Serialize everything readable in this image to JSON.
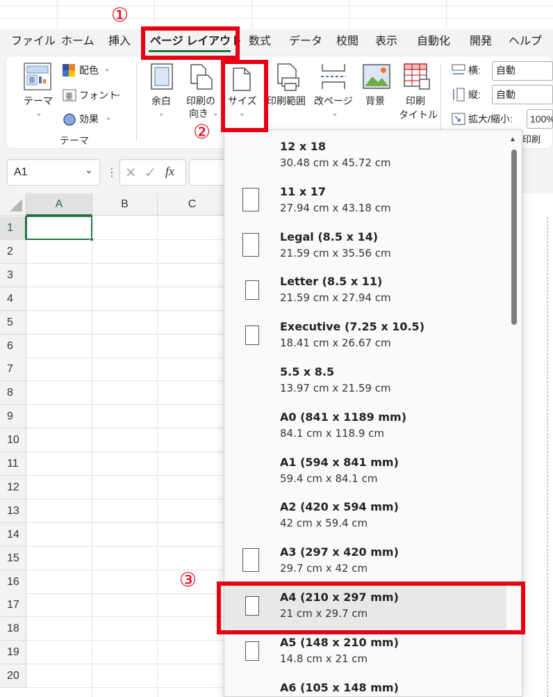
{
  "tabs": [
    {
      "label": "ファイル"
    },
    {
      "label": "ホーム"
    },
    {
      "label": "挿入"
    },
    {
      "label": "ページ レイアウト"
    },
    {
      "label": "数式"
    },
    {
      "label": "データ"
    },
    {
      "label": "校閲"
    },
    {
      "label": "表示"
    },
    {
      "label": "自動化"
    },
    {
      "label": "開発"
    },
    {
      "label": "ヘルプ"
    }
  ],
  "ribbon": {
    "theme_button": "テーマ",
    "colors": "配色",
    "fonts": "フォント",
    "effects": "効果",
    "group_theme": "テーマ",
    "margins_label": "余白",
    "orientation_label_1": "印刷の",
    "orientation_label_2": "向き",
    "size_label": "サイズ",
    "print_area_label": "印刷範囲",
    "breaks_label": "改ページ",
    "background_label": "背景",
    "print_titles_label_1": "印刷",
    "print_titles_label_2": "タイトル",
    "width_label": "横:",
    "width_value": "自動",
    "height_label": "縦:",
    "height_value": "自動",
    "scale_label": "拡大/縮小:",
    "scale_value": "100%",
    "group_print": "印刷"
  },
  "formula_bar": {
    "name_box": "A1",
    "fx": "fx"
  },
  "grid": {
    "columns": [
      "A",
      "B",
      "C"
    ],
    "rows": [
      "1",
      "2",
      "3",
      "4",
      "5",
      "6",
      "7",
      "8",
      "9",
      "10",
      "11",
      "12",
      "13",
      "14",
      "15",
      "16",
      "17",
      "18",
      "19",
      "20"
    ]
  },
  "size_menu": {
    "items": [
      {
        "title": "12 x 18",
        "sub": "30.48 cm x 45.72 cm",
        "icon": "none"
      },
      {
        "title": "11 x 17",
        "sub": "27.94 cm x 43.18 cm",
        "icon": "page-icon"
      },
      {
        "title": "Legal (8.5 x 14)",
        "sub": "21.59 cm x 35.56 cm",
        "icon": "page-icon"
      },
      {
        "title": "Letter (8.5 x 11)",
        "sub": "21.59 cm x 27.94 cm",
        "icon": "page-icon"
      },
      {
        "title": "Executive (7.25 x 10.5)",
        "sub": "18.41 cm x 26.67 cm",
        "icon": "page-icon"
      },
      {
        "title": "5.5 x 8.5",
        "sub": "13.97 cm x 21.59 cm",
        "icon": "none"
      },
      {
        "title": "A0 (841 x 1189 mm)",
        "sub": "84.1 cm x 118.9 cm",
        "icon": "none"
      },
      {
        "title": "A1 (594 x 841 mm)",
        "sub": "59.4 cm x 84.1 cm",
        "icon": "none"
      },
      {
        "title": "A2 (420 x 594 mm)",
        "sub": "42 cm x 59.4 cm",
        "icon": "none"
      },
      {
        "title": "A3 (297 x 420 mm)",
        "sub": "29.7 cm x 42 cm",
        "icon": "page-icon"
      },
      {
        "title": "A4 (210 x 297 mm)",
        "sub": "21 cm x 29.7 cm",
        "icon": "page-icon",
        "selected": true
      },
      {
        "title": "A5 (148 x 210 mm)",
        "sub": "14.8 cm x 21 cm",
        "icon": "page-icon"
      },
      {
        "title": "A6 (105 x 148 mm)",
        "sub": "",
        "icon": "none"
      }
    ]
  },
  "annotations": {
    "step1": "①",
    "step2": "②",
    "step3": "③",
    "color": "#e60012"
  },
  "colors": {
    "accent": "#217346"
  }
}
